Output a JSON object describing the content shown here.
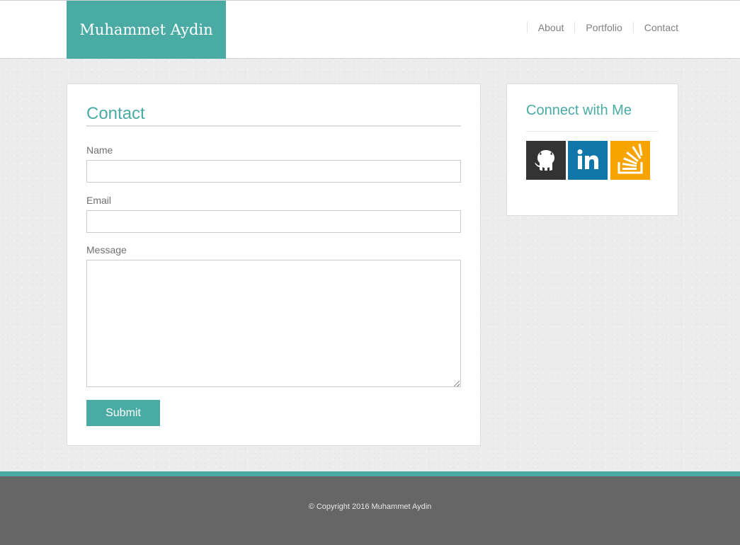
{
  "header": {
    "brand": "Muhammet Aydin",
    "nav": [
      {
        "label": "About"
      },
      {
        "label": "Portfolio"
      },
      {
        "label": "Contact"
      }
    ]
  },
  "contact_form": {
    "title": "Contact",
    "name_label": "Name",
    "name_value": "",
    "email_label": "Email",
    "email_value": "",
    "message_label": "Message",
    "message_value": "",
    "submit_label": "Submit"
  },
  "connect": {
    "title": "Connect with Me",
    "links": [
      {
        "icon": "github-icon",
        "color": "#333333"
      },
      {
        "icon": "linkedin-icon",
        "color": "#0e76a8"
      },
      {
        "icon": "stackoverflow-icon",
        "color": "#f7a300"
      }
    ]
  },
  "footer": {
    "copyright": "© Copyright 2016 Muhammet Aydin"
  },
  "colors": {
    "accent": "#4aaba4",
    "footer_bg": "#666666",
    "page_bg": "#ececec"
  }
}
